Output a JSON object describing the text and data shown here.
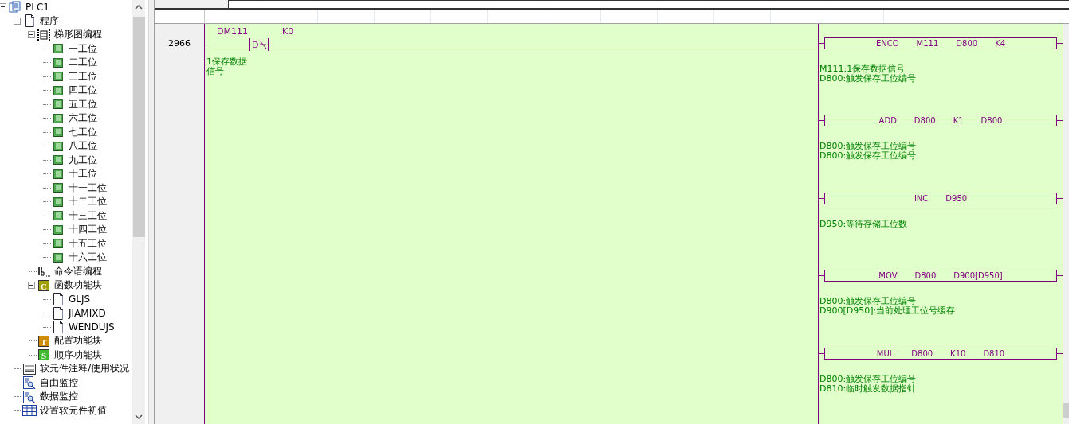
{
  "tree": [
    {
      "label": "PLC1",
      "kind": "project",
      "expanded": true,
      "children": [
        {
          "label": "程序",
          "kind": "document",
          "expanded": true,
          "children": [
            {
              "label": "梯形图编程",
              "kind": "ladder",
              "expanded": true,
              "children": [
                {
                  "label": "一工位",
                  "kind": "block"
                },
                {
                  "label": "二工位",
                  "kind": "block"
                },
                {
                  "label": "三工位",
                  "kind": "block"
                },
                {
                  "label": "四工位",
                  "kind": "block"
                },
                {
                  "label": "五工位",
                  "kind": "block"
                },
                {
                  "label": "六工位",
                  "kind": "block"
                },
                {
                  "label": "七工位",
                  "kind": "block"
                },
                {
                  "label": "八工位",
                  "kind": "block"
                },
                {
                  "label": "九工位",
                  "kind": "block"
                },
                {
                  "label": "十工位",
                  "kind": "block"
                },
                {
                  "label": "十一工位",
                  "kind": "block"
                },
                {
                  "label": "十二工位",
                  "kind": "block"
                },
                {
                  "label": "十三工位",
                  "kind": "block"
                },
                {
                  "label": "十四工位",
                  "kind": "block"
                },
                {
                  "label": "十五工位",
                  "kind": "block"
                },
                {
                  "label": "十六工位",
                  "kind": "block"
                }
              ]
            },
            {
              "label": "命令语编程",
              "kind": "instruction"
            },
            {
              "label": "函数功能块",
              "kind": "badge",
              "badge": "C",
              "color": "#a0a000",
              "expanded": true,
              "children": [
                {
                  "label": "GLJS",
                  "kind": "document"
                },
                {
                  "label": "JIAMIXD",
                  "kind": "document"
                },
                {
                  "label": "WENDUJS",
                  "kind": "document"
                }
              ]
            },
            {
              "label": "配置功能块",
              "kind": "badge",
              "badge": "T",
              "color": "#d08c00"
            },
            {
              "label": "顺序功能块",
              "kind": "badge",
              "badge": "S",
              "color": "#40b830"
            }
          ]
        },
        {
          "label": "软元件注释/使用状况",
          "kind": "list"
        },
        {
          "label": "自由监控",
          "kind": "monitor"
        },
        {
          "label": "数据监控",
          "kind": "monitor"
        },
        {
          "label": "设置软元件初值",
          "kind": "table"
        }
      ]
    }
  ],
  "rungs": [
    {
      "number": "2966",
      "contact": {
        "device": "DM111",
        "operand": "K0",
        "symbol": "D",
        "comment": [
          "1保存数据",
          "信号"
        ]
      },
      "instructions": [
        {
          "operands": [
            "ENCO",
            "M111",
            "D800",
            "K4"
          ],
          "comments": [
            "M111:1保存数据信号",
            "D800:触发保存工位编号"
          ]
        },
        {
          "operands": [
            "ADD",
            "D800",
            "K1",
            "D800"
          ],
          "comments": [
            "D800:触发保存工位编号",
            "D800:触发保存工位编号"
          ]
        },
        {
          "operands": [
            "INC",
            "D950"
          ],
          "comments": [
            "D950:等待存储工位数"
          ]
        },
        {
          "operands": [
            "MOV",
            "D800",
            "D900[D950]"
          ],
          "comments": [
            "D800:触发保存工位编号",
            "D900[D950]:当前处理工位号缓存"
          ]
        },
        {
          "operands": [
            "MUL",
            "D800",
            "K10",
            "D810"
          ],
          "comments": [
            "D800:触发保存工位编号",
            "D810:临时触发数据指针"
          ]
        }
      ]
    }
  ]
}
